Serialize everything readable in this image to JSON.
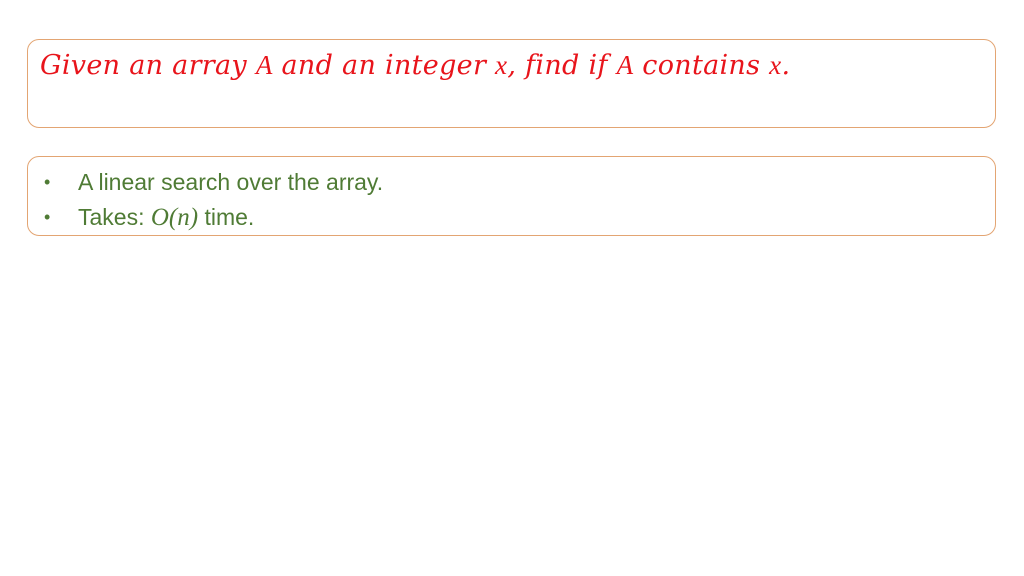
{
  "title": {
    "parts": [
      "Given an array ",
      "A",
      " and an integer ",
      "x",
      ", find if ",
      "A",
      " contains ",
      "x",
      "."
    ]
  },
  "bullets": [
    {
      "bullet": "•",
      "text": "A linear search over the array."
    },
    {
      "bullet": "•",
      "pre": "Takes: ",
      "math": "O(n)",
      "post": " time."
    }
  ],
  "colors": {
    "title": "#E8141B",
    "body": "#4F7B35",
    "border": "#E3A573"
  }
}
